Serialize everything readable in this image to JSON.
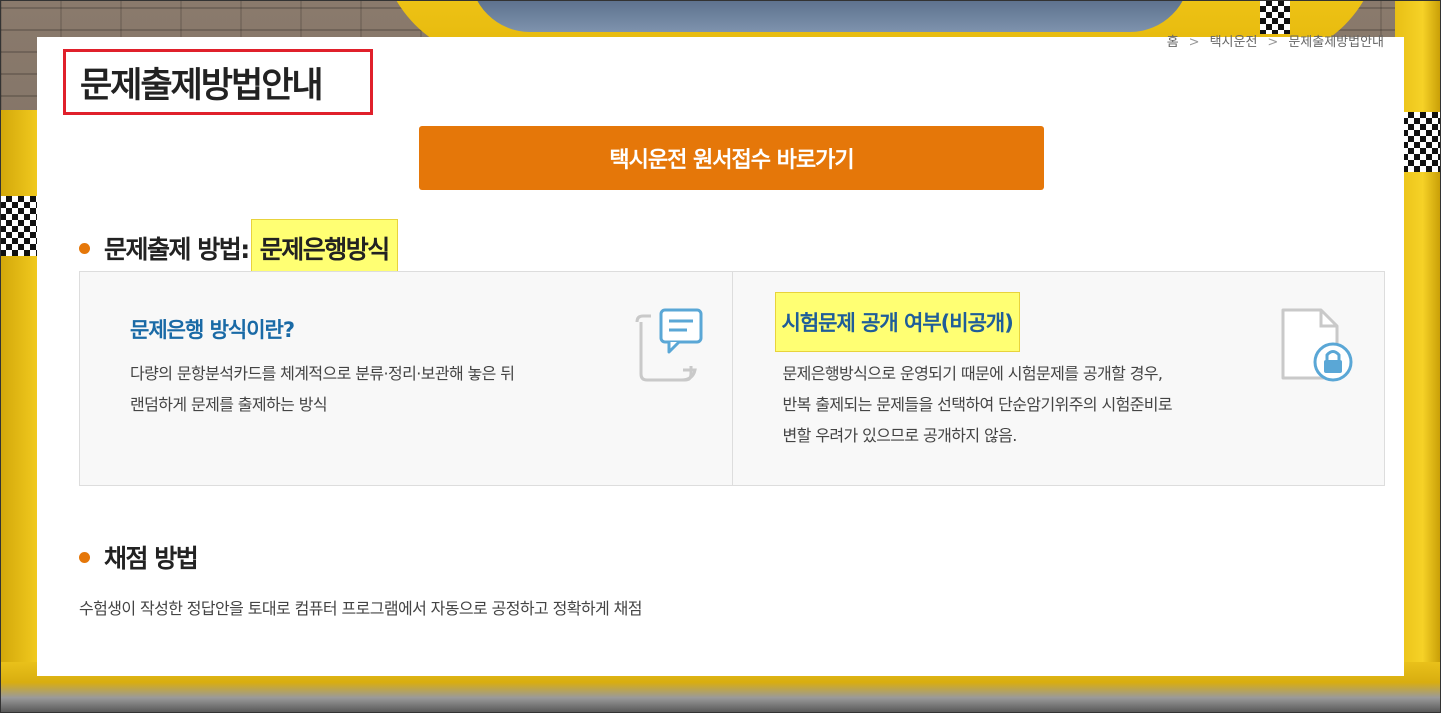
{
  "breadcrumb": {
    "home": "홈",
    "category": "택시운전",
    "current": "문제출제방법안내"
  },
  "page": {
    "title": "문제출제방법안내"
  },
  "apply_button": {
    "label": "택시운전 원서접수 바로가기"
  },
  "method_section": {
    "heading_prefix": "문제출제 방법:",
    "heading_highlight": "문제은행방식"
  },
  "cards": [
    {
      "title": "문제은행 방식이란?",
      "lines": [
        "다량의 문항분석카드를 체계적으로 분류·정리·보관해 놓은 뒤",
        "랜덤하게 문제를 출제하는 방식"
      ],
      "icon": "document-chat-icon"
    },
    {
      "title": "시험문제 공개 여부(비공개)",
      "lines": [
        "문제은행방식으로 운영되기 때문에 시험문제를 공개할 경우,",
        "반복 출제되는 문제들을 선택하여 단순암기위주의 시험준비로",
        "변할 우려가 있으므로 공개하지 않음."
      ],
      "icon": "document-lock-icon"
    }
  ],
  "scoring_section": {
    "heading": "채점 방법",
    "text": "수험생이 작성한 정답안을 토대로 컴퓨터 프로그램에서 자동으로 공정하고 정확하게 채점"
  },
  "colors": {
    "accent_orange": "#e57709",
    "title_blue": "#1a6aa6",
    "highlight_yellow": "#ffff73",
    "annotation_red": "#e0202b"
  }
}
